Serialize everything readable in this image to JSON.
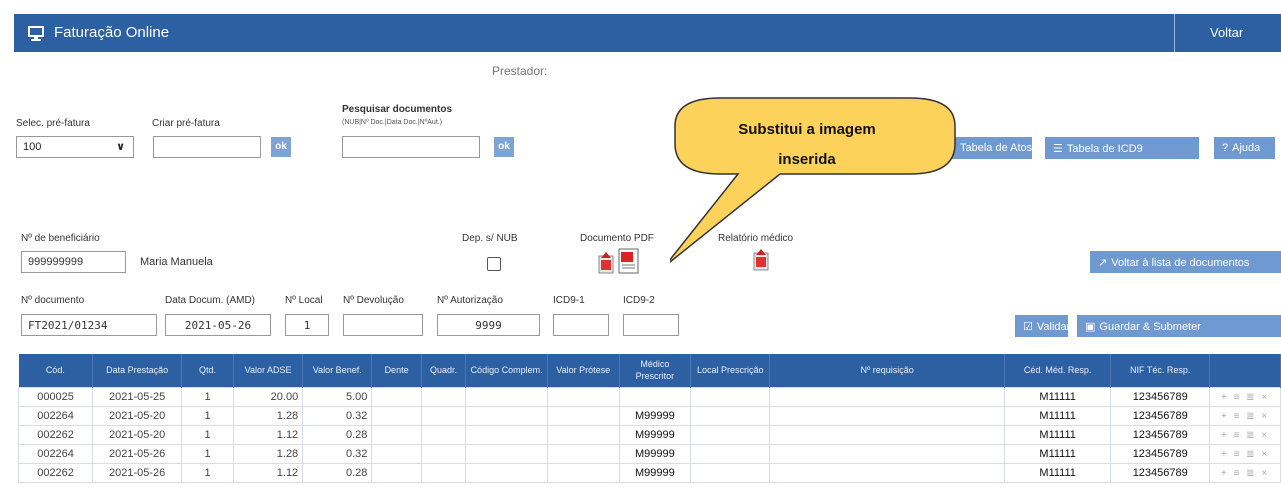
{
  "header": {
    "title": "Faturação Online",
    "back_label": "Voltar"
  },
  "prestador_label": "Prestador:",
  "prefatura": {
    "select_label": "Selec. pré-fatura",
    "select_value": "100",
    "create_label": "Criar pré-fatura",
    "create_value": "",
    "ok_label": "ok"
  },
  "search": {
    "label": "Pesquisar documentos",
    "hint": "(NUB|Nº Doc.|Data Doc.|NºAut.)",
    "value": "",
    "ok_label": "ok"
  },
  "tools": {
    "tabela_atos": "Tabela de Atos",
    "tabela_icd9": "Tabela de ICD9",
    "ajuda": "Ajuda"
  },
  "callout": {
    "line1": "Substitui a imagem",
    "line2": "inserida"
  },
  "beneficiary": {
    "label": "Nº de beneficiário",
    "number": "999999999",
    "name": "Maria Manuela",
    "dep_label": "Dep. s/ NUB",
    "pdf_label": "Documento PDF",
    "relatorio_label": "Relatório médico",
    "back_list": "Voltar à lista de documentos"
  },
  "document": {
    "numero_label": "Nº documento",
    "numero": "FT2021/01234",
    "data_label": "Data Docum. (AMD)",
    "data": "2021-05-26",
    "local_label": "Nº Local",
    "local": "1",
    "devolucao_label": "Nº Devolução",
    "devolucao": "",
    "autorizacao_label": "Nº Autorização",
    "autorizacao": "9999",
    "icd1_label": "ICD9-1",
    "icd1": "",
    "icd2_label": "ICD9-2",
    "icd2": "",
    "validar": "Validar",
    "guardar": "Guardar & Submeter"
  },
  "table": {
    "headers": [
      "Cód.",
      "Data Prestação",
      "Qtd.",
      "Valor ADSE",
      "Valor Benef.",
      "Dente",
      "Quadr.",
      "Código Complem.",
      "Valor Prótese",
      "Médico Prescritor",
      "Local Prescrição",
      "Nº requisição",
      "Céd. Méd. Resp.",
      "NIF Téc. Resp.",
      ""
    ],
    "rows": [
      [
        "000025",
        "2021-05-25",
        "1",
        "20.00",
        "5.00",
        "",
        "",
        "",
        "",
        "",
        "",
        "",
        "M11111",
        "123456789"
      ],
      [
        "002264",
        "2021-05-20",
        "1",
        "1.28",
        "0.32",
        "",
        "",
        "",
        "",
        "M99999",
        "",
        "",
        "M11111",
        "123456789"
      ],
      [
        "002262",
        "2021-05-20",
        "1",
        "1.12",
        "0.28",
        "",
        "",
        "",
        "",
        "M99999",
        "",
        "",
        "M11111",
        "123456789"
      ],
      [
        "002264",
        "2021-05-26",
        "1",
        "1.28",
        "0.32",
        "",
        "",
        "",
        "",
        "M99999",
        "",
        "",
        "M11111",
        "123456789"
      ],
      [
        "002262",
        "2021-05-26",
        "1",
        "1.12",
        "0.28",
        "",
        "",
        "",
        "",
        "M99999",
        "",
        "",
        "M11111",
        "123456789"
      ]
    ],
    "row_actions": "+ ≡ ≣ ×"
  },
  "colors": {
    "header_bg": "#2d5fa3",
    "button_bg": "#6f9ad1",
    "callout_fill": "#fcd25a"
  }
}
